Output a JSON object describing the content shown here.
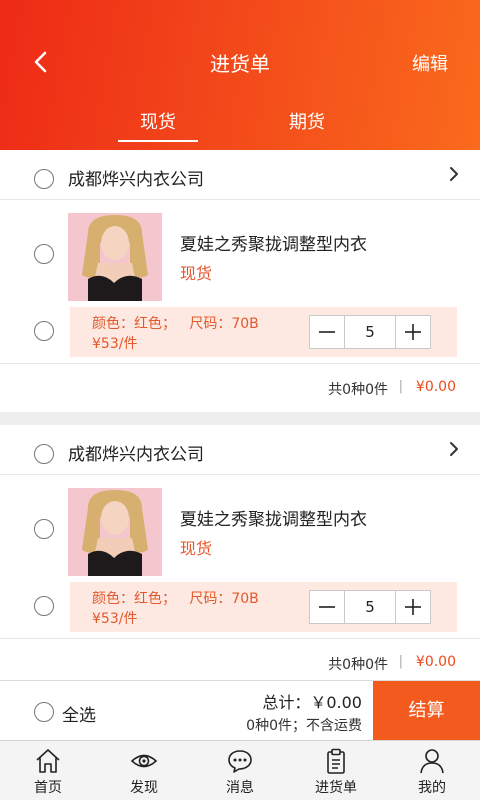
{
  "header": {
    "title": "进货单",
    "edit_label": "编辑",
    "tabs": [
      {
        "label": "现货",
        "active": true
      },
      {
        "label": "期货",
        "active": false
      }
    ]
  },
  "stores": [
    {
      "name": "成都烨兴内衣公司",
      "product": {
        "name": "夏娃之秀聚拢调整型内衣",
        "tag": "现货",
        "spec": "颜色：红色；   尺码：70B",
        "price": "¥53/件",
        "quantity": "5"
      },
      "summary": {
        "count": "共0种0件",
        "separator": "|",
        "amount": "¥0.00"
      }
    },
    {
      "name": "成都烨兴内衣公司",
      "product": {
        "name": "夏娃之秀聚拢调整型内衣",
        "tag": "现货",
        "spec": "颜色：红色；   尺码：70B",
        "price": "¥53/件",
        "quantity": "5"
      },
      "summary": {
        "count": "共0种0件",
        "separator": "|",
        "amount": "¥0.00"
      }
    }
  ],
  "checkout": {
    "select_all_label": "全选",
    "total_line": "总计：￥0.00",
    "sub_line": "0种0件；不含运费",
    "settle_label": "结算"
  },
  "nav": [
    {
      "label": "首页",
      "icon": "home-icon"
    },
    {
      "label": "发现",
      "icon": "eye-icon"
    },
    {
      "label": "消息",
      "icon": "chat-icon"
    },
    {
      "label": "进货单",
      "icon": "clipboard-icon"
    },
    {
      "label": "我的",
      "icon": "user-icon"
    }
  ],
  "colors": {
    "accent": "#f25a1e",
    "header_start": "#ee2a16",
    "header_end": "#fa6a1c",
    "spec_bg": "#fde8e2",
    "price_text": "#e25a2c"
  }
}
